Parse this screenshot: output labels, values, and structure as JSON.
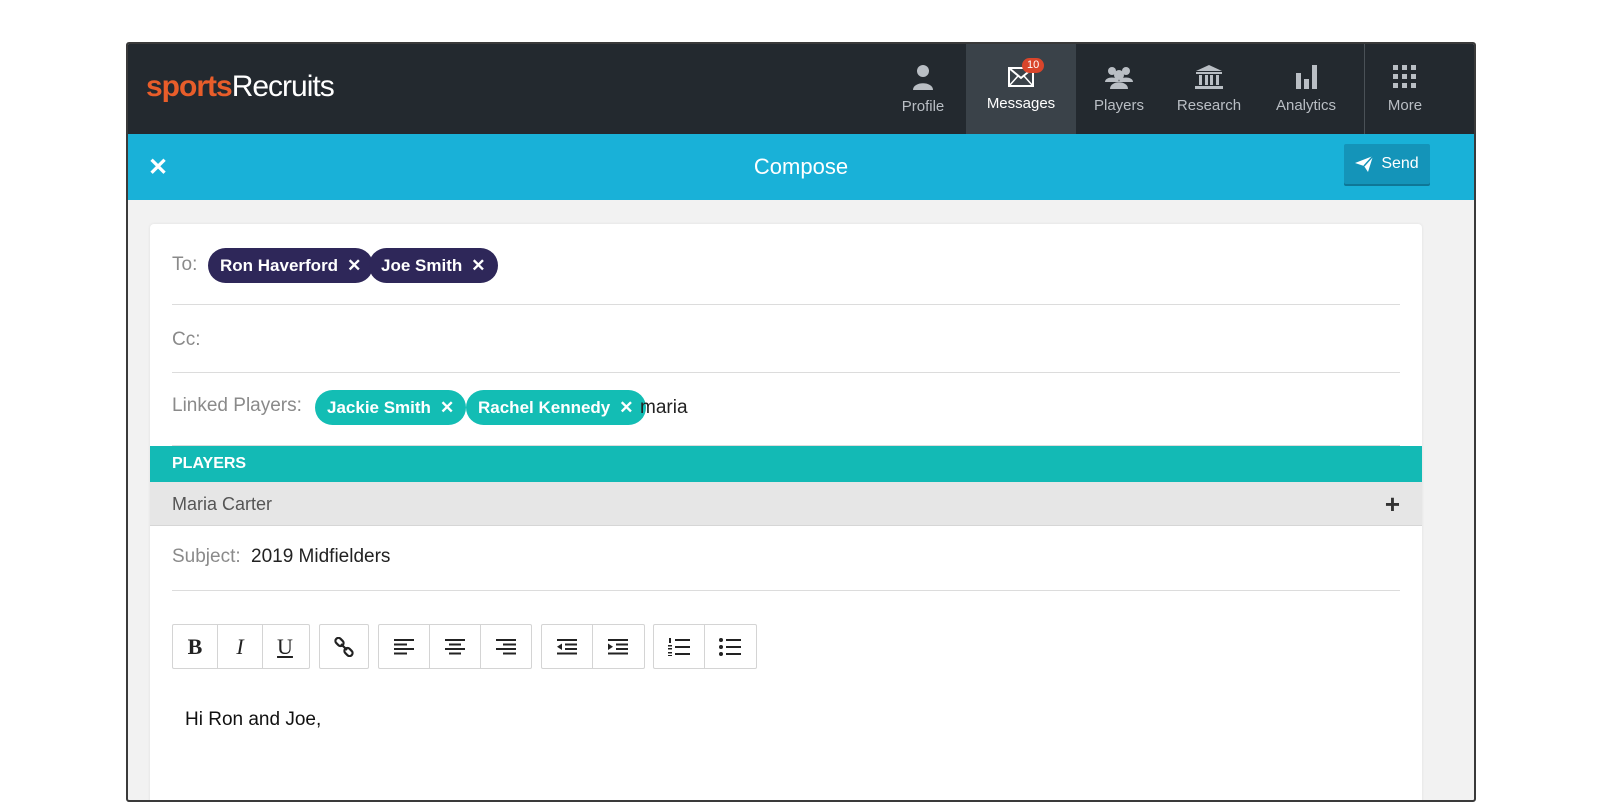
{
  "brand": {
    "part1": "sports",
    "part2": "Recruits"
  },
  "nav": {
    "items": [
      {
        "label": "Profile",
        "icon": "person-icon",
        "active": false
      },
      {
        "label": "Messages",
        "icon": "envelope-icon",
        "active": true,
        "badge": "10"
      },
      {
        "label": "Players",
        "icon": "group-icon",
        "active": false
      },
      {
        "label": "Research",
        "icon": "bank-icon",
        "active": false
      },
      {
        "label": "Analytics",
        "icon": "bar-chart-icon",
        "active": false
      },
      {
        "label": "More",
        "icon": "grid-icon",
        "active": false
      }
    ]
  },
  "compose": {
    "title": "Compose",
    "close_icon": "close-icon",
    "send_label": "Send",
    "send_icon": "paper-plane-icon"
  },
  "to": {
    "label": "To:",
    "recipients": [
      "Ron Haverford",
      "Joe Smith"
    ]
  },
  "cc": {
    "label": "Cc:"
  },
  "linked": {
    "label": "Linked Players:",
    "players": [
      "Jackie Smith",
      "Rachel Kennedy"
    ],
    "query": "maria"
  },
  "dropdown": {
    "header": "PLAYERS",
    "results": [
      "Maria Carter"
    ],
    "add_icon": "plus-icon"
  },
  "subject": {
    "label": "Subject:",
    "value": "2019 Midfielders"
  },
  "toolbar": {
    "bold": "B",
    "italic": "I",
    "underline": "U",
    "icons": [
      "link-icon",
      "align-left-icon",
      "align-center-icon",
      "align-right-icon",
      "outdent-icon",
      "indent-icon",
      "ordered-list-icon",
      "unordered-list-icon"
    ]
  },
  "body": {
    "text": "Hi Ron and Joe,"
  },
  "colors": {
    "topbar": "#23292f",
    "compose_bar": "#19b1d8",
    "brand_orange": "#e85d2a",
    "navy_chip": "#2e2759",
    "teal": "#13bdb4"
  }
}
